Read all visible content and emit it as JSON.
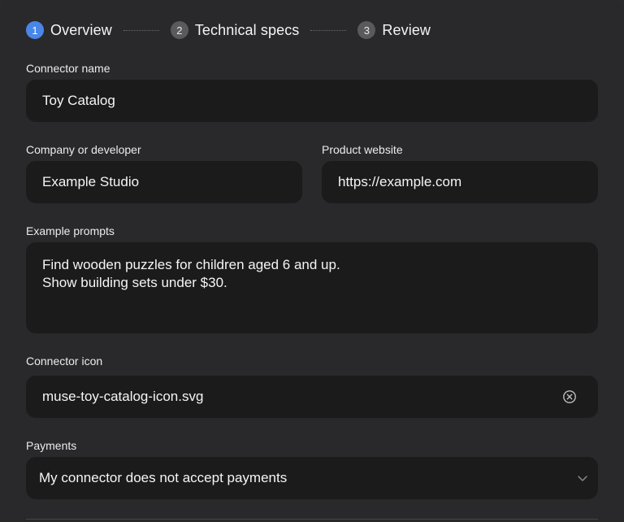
{
  "stepper": {
    "steps": [
      {
        "num": "1",
        "label": "Overview",
        "active": true
      },
      {
        "num": "2",
        "label": "Technical specs",
        "active": false
      },
      {
        "num": "3",
        "label": "Review",
        "active": false
      }
    ]
  },
  "form": {
    "connector_name": {
      "label": "Connector name",
      "value": "Toy Catalog"
    },
    "company": {
      "label": "Company or developer",
      "value": "Example Studio"
    },
    "website": {
      "label": "Product website",
      "value": "https://example.com"
    },
    "prompts": {
      "label": "Example prompts",
      "value": "Find wooden puzzles for children aged 6 and up.\nShow building sets under $30."
    },
    "icon": {
      "label": "Connector icon",
      "value": "muse-toy-catalog-icon.svg",
      "clear_icon": "clear-circle-icon"
    },
    "payments": {
      "label": "Payments",
      "value": "My connector does not accept payments",
      "chevron_icon": "chevron-down-icon"
    }
  },
  "colors": {
    "accent": "#4a86e8",
    "panel": "#29292b",
    "field": "#1b1b1c"
  }
}
